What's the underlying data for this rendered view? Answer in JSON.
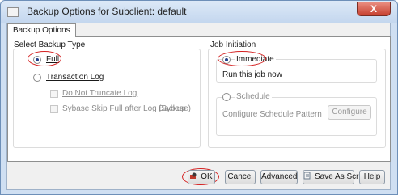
{
  "window": {
    "title": "Backup Options for Subclient: default",
    "close_glyph": "X"
  },
  "tabs": [
    {
      "label": "Backup Options"
    }
  ],
  "backup_type": {
    "heading": "Select Backup Type",
    "full_label": "Full",
    "transaction_log_label": "Transaction Log",
    "no_truncate_label": "Do Not Truncate Log",
    "sybase_skip_label": "Sybase Skip Full after Log Backup",
    "sybase_hint": "(Sybese)"
  },
  "job_initiation": {
    "heading": "Job Initiation",
    "immediate_label": "Immediate",
    "run_now_text": "Run this job now",
    "schedule_label": "Schedule",
    "configure_pattern_text": "Configure Schedule Pattern",
    "configure_button": "Configure"
  },
  "footer": {
    "ok": "OK",
    "cancel": "Cancel",
    "advanced": "Advanced",
    "save_script": "Save As Script",
    "help": "Help"
  }
}
